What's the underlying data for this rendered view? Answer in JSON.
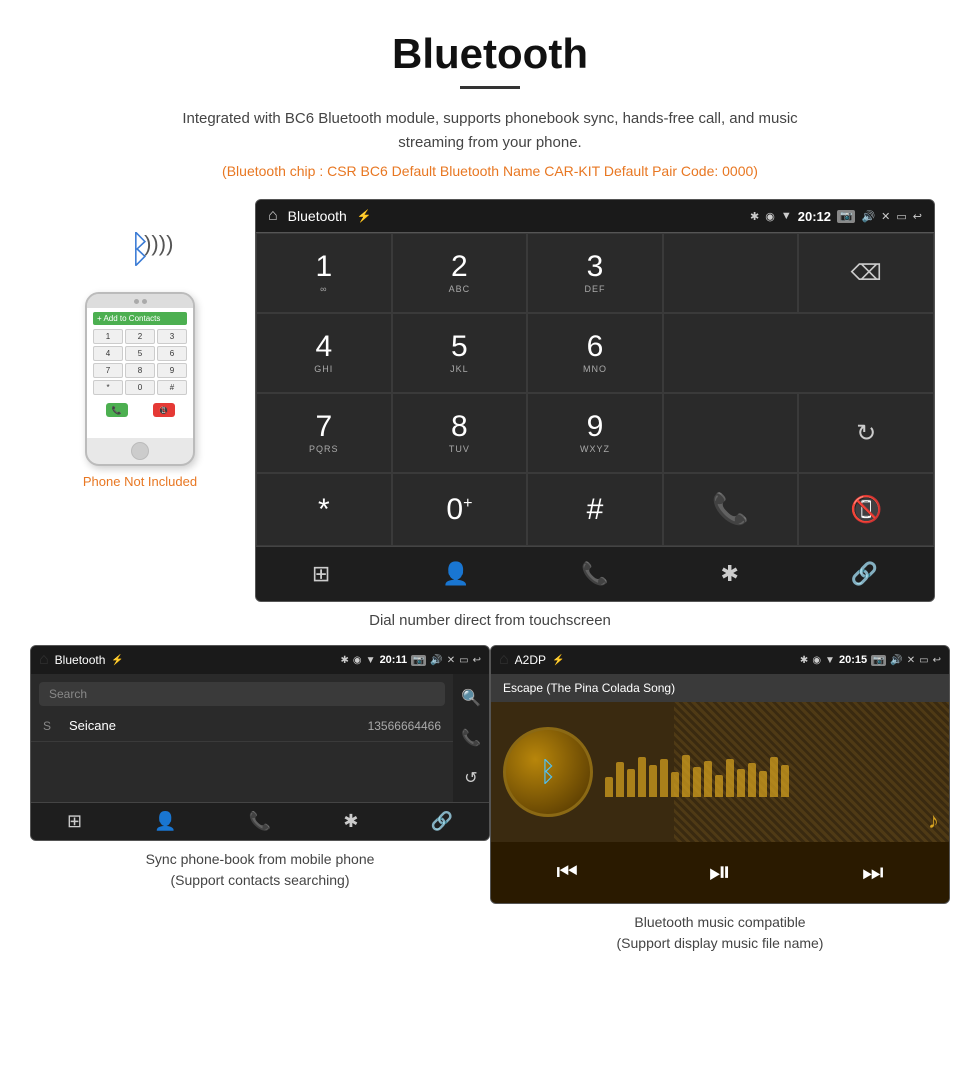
{
  "page": {
    "title": "Bluetooth",
    "subtitle": "Integrated with BC6 Bluetooth module, supports phonebook sync, hands-free call, and music streaming from your phone.",
    "orange_info": "(Bluetooth chip : CSR BC6    Default Bluetooth Name CAR-KIT    Default Pair Code: 0000)",
    "dial_caption": "Dial number direct from touchscreen",
    "bottom_left_caption": "Sync phone-book from mobile phone\n(Support contacts searching)",
    "bottom_right_caption": "Bluetooth music compatible\n(Support display music file name)"
  },
  "dial_screen": {
    "status_bar": {
      "home_icon": "⌂",
      "title": "Bluetooth",
      "usb_icon": "⚡",
      "time": "20:12",
      "bt_icon": "✱",
      "location_icon": "◉",
      "signal_icon": "▼",
      "camera_icon": "📷",
      "volume_icon": "🔊",
      "close_icon": "✕",
      "window_icon": "▭",
      "back_icon": "↩"
    },
    "keys": [
      {
        "number": "1",
        "letters": "∞",
        "row": 0,
        "col": 0
      },
      {
        "number": "2",
        "letters": "ABC",
        "row": 0,
        "col": 1
      },
      {
        "number": "3",
        "letters": "DEF",
        "row": 0,
        "col": 2
      },
      {
        "number": "4",
        "letters": "GHI",
        "row": 1,
        "col": 0
      },
      {
        "number": "5",
        "letters": "JKL",
        "row": 1,
        "col": 1
      },
      {
        "number": "6",
        "letters": "MNO",
        "row": 1,
        "col": 2
      },
      {
        "number": "7",
        "letters": "PQRS",
        "row": 2,
        "col": 0
      },
      {
        "number": "8",
        "letters": "TUV",
        "row": 2,
        "col": 1
      },
      {
        "number": "9",
        "letters": "WXYZ",
        "row": 2,
        "col": 2
      },
      {
        "number": "*",
        "letters": "",
        "row": 3,
        "col": 0
      },
      {
        "number": "0⁺",
        "letters": "",
        "row": 3,
        "col": 1
      },
      {
        "number": "#",
        "letters": "",
        "row": 3,
        "col": 2
      }
    ],
    "bottom_nav_icons": [
      "⊞",
      "👤",
      "📞",
      "✱",
      "🔗"
    ]
  },
  "phonebook_screen": {
    "status_bar": {
      "home_icon": "⌂",
      "title": "Bluetooth",
      "usb_icon": "⚡",
      "time": "20:11",
      "bt_icon": "✱",
      "camera_icon": "📷",
      "volume_icon": "🔊"
    },
    "search_placeholder": "Search",
    "contacts": [
      {
        "letter": "S",
        "name": "Seicane",
        "number": "13566664466"
      }
    ],
    "side_icons": [
      "🔍",
      "📞",
      "↺"
    ],
    "bottom_nav_icons": [
      "⊞",
      "👤",
      "📞",
      "✱",
      "🔗"
    ]
  },
  "music_screen": {
    "status_bar": {
      "home_icon": "⌂",
      "title": "A2DP",
      "usb_icon": "⚡",
      "time": "20:15",
      "bt_icon": "✱",
      "camera_icon": "📷",
      "volume_icon": "🔊"
    },
    "song_title": "Escape (The Pina Colada Song)",
    "eq_bars": [
      20,
      35,
      28,
      40,
      32,
      38,
      25,
      42,
      30,
      36,
      22,
      38,
      28,
      34,
      26,
      40,
      32
    ],
    "controls": {
      "prev": "⏮",
      "play_pause": "⏯",
      "next": "⏭"
    }
  },
  "phone_mockup": {
    "not_included": "Phone Not Included",
    "header_label": "+ Add to Contacts",
    "keys": [
      "1",
      "2",
      "3",
      "4",
      "5",
      "6",
      "7",
      "8",
      "9",
      "*",
      "0",
      "#"
    ]
  },
  "bluetooth_symbol": "ᛒ"
}
